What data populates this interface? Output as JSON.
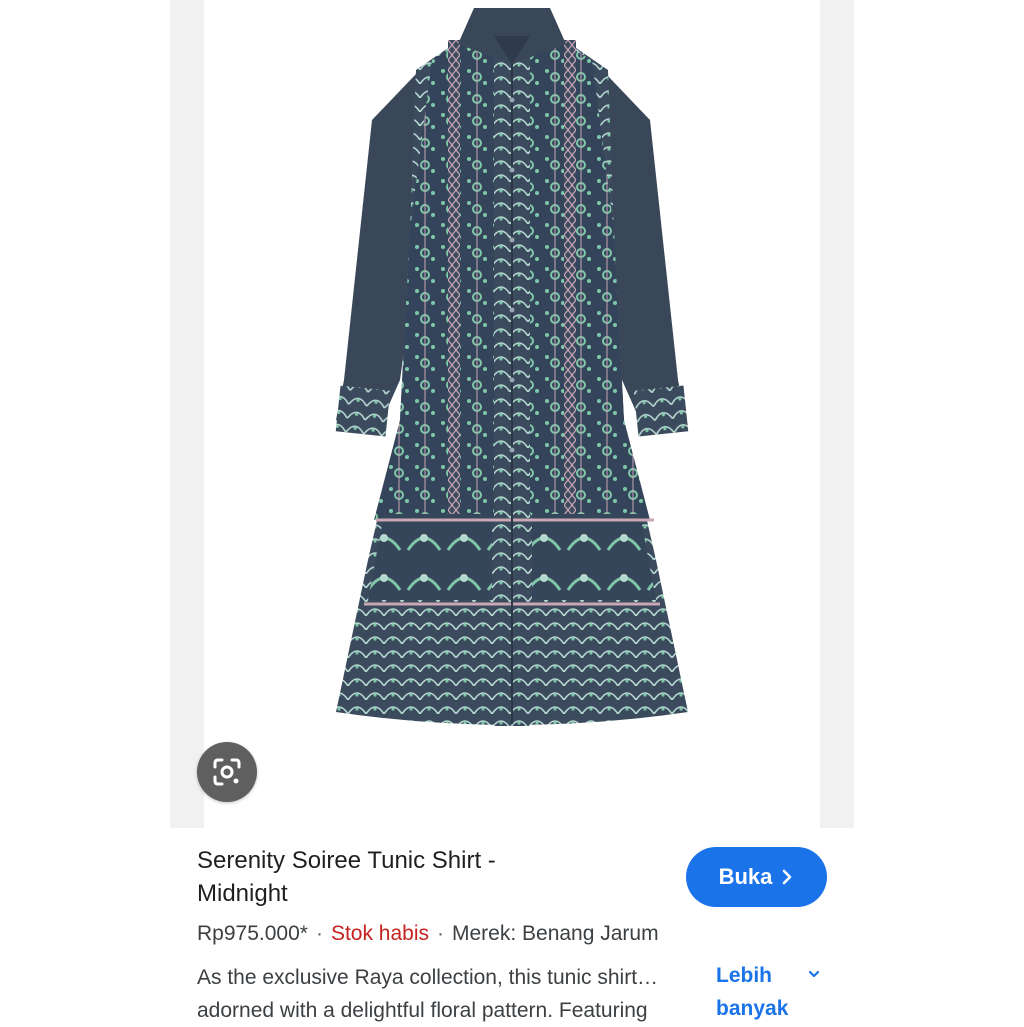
{
  "product": {
    "image_alt": "Serenity Soiree Tunic Shirt - Midnight",
    "colors": {
      "fabric": "#3b4a5c",
      "pattern_green": "#7fc7a8",
      "pattern_pink": "#c9a7b5",
      "pattern_light": "#b6d8d2"
    },
    "lens_icon": "google-lens-icon",
    "title_line1": "Serenity Soiree Tunic Shirt -",
    "title_line2": "Midnight",
    "open_label": "Buka",
    "open_icon": "chevron-right-icon",
    "price": "Rp975.000*",
    "separator": "·",
    "stock": "Stok habis",
    "brand": "Merek: Benang Jarum",
    "description_line1": "As the exclusive Raya collection, this tunic shirt…",
    "description_line2": "adorned with a delightful floral pattern. Featuring",
    "more_label_line1": "Lebih",
    "more_label_line2": "banyak",
    "more_icon": "chevron-down-icon",
    "accent": "#1a73e8",
    "stock_color": "#c5221f"
  }
}
